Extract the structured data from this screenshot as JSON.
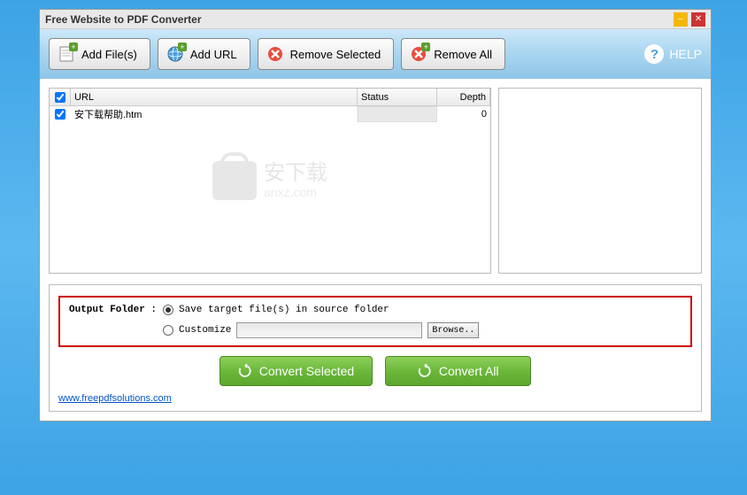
{
  "window": {
    "title": "Free Website to PDF Converter"
  },
  "toolbar": {
    "addFiles": "Add File(s)",
    "addUrl": "Add URL",
    "removeSelected": "Remove Selected",
    "removeAll": "Remove All",
    "help": "HELP"
  },
  "table": {
    "headers": {
      "url": "URL",
      "status": "Status",
      "depth": "Depth"
    },
    "rows": [
      {
        "checked": true,
        "url": "安下载帮助.htm",
        "status": "",
        "depth": "0"
      }
    ]
  },
  "watermark": {
    "text": "安下载",
    "sub": "anxz.com"
  },
  "output": {
    "label": "Output Folder :",
    "option1": "Save target file(s) in source folder",
    "option2": "Customize",
    "browse": "Browse.."
  },
  "convert": {
    "selected": "Convert Selected",
    "all": "Convert All"
  },
  "footer": {
    "link": "www.freepdfsolutions.com"
  }
}
